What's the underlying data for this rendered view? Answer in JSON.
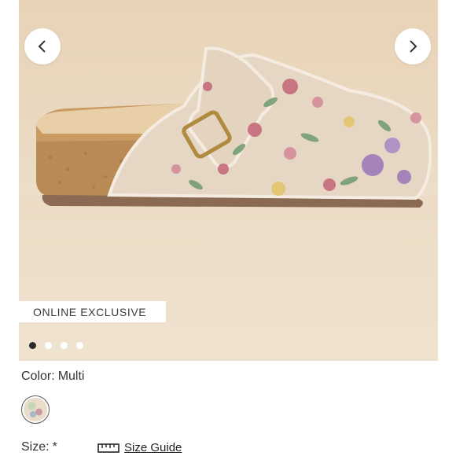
{
  "gallery": {
    "badge": "ONLINE EXCLUSIVE",
    "prev_icon": "chevron-left-icon",
    "next_icon": "chevron-right-icon",
    "slides_total": 4,
    "active_slide": 1
  },
  "product": {
    "color_label": "Color:",
    "color_value": "Multi",
    "size_label": "Size:",
    "size_required": "*",
    "size_guide_label": "Size Guide",
    "size_guide_icon": "ruler-icon"
  },
  "colors": {
    "active_dot": "#2b2b2b",
    "badge_bg": "#ffffff",
    "background": "#e8d3b6"
  }
}
